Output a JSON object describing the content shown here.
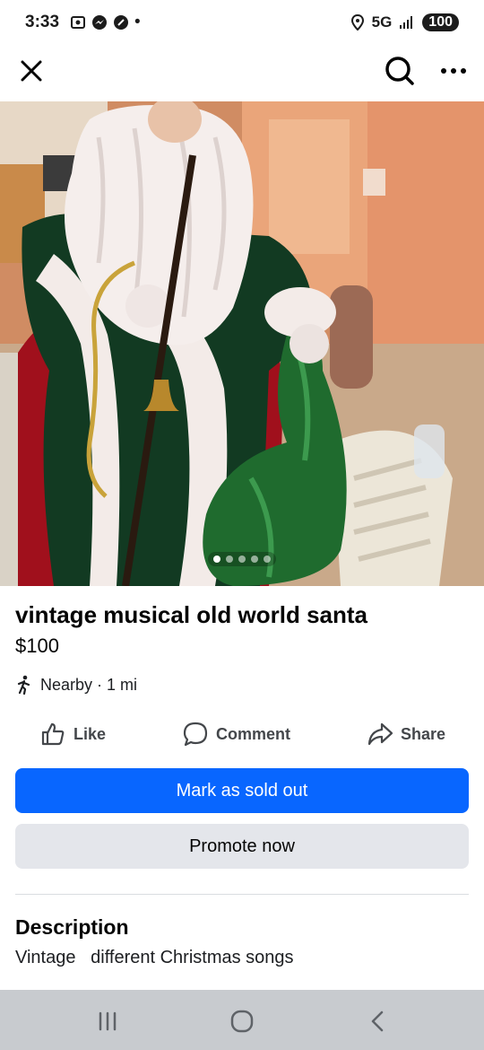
{
  "status_bar": {
    "time": "3:33",
    "network": "5G",
    "battery": "100"
  },
  "listing": {
    "title": "vintage musical old world santa",
    "price": "$100",
    "distance": "Nearby · 1 mi",
    "photo_count": 5,
    "active_photo_index": 0
  },
  "actions": {
    "like": "Like",
    "comment": "Comment",
    "share": "Share"
  },
  "buttons": {
    "mark_sold": "Mark as sold out",
    "promote": "Promote now"
  },
  "description": {
    "heading": "Description",
    "text": "Vintage   different Christmas songs"
  },
  "colors": {
    "primary": "#0866ff",
    "secondary_button": "#e4e6eb",
    "nav_bar": "#c8cbcf"
  }
}
